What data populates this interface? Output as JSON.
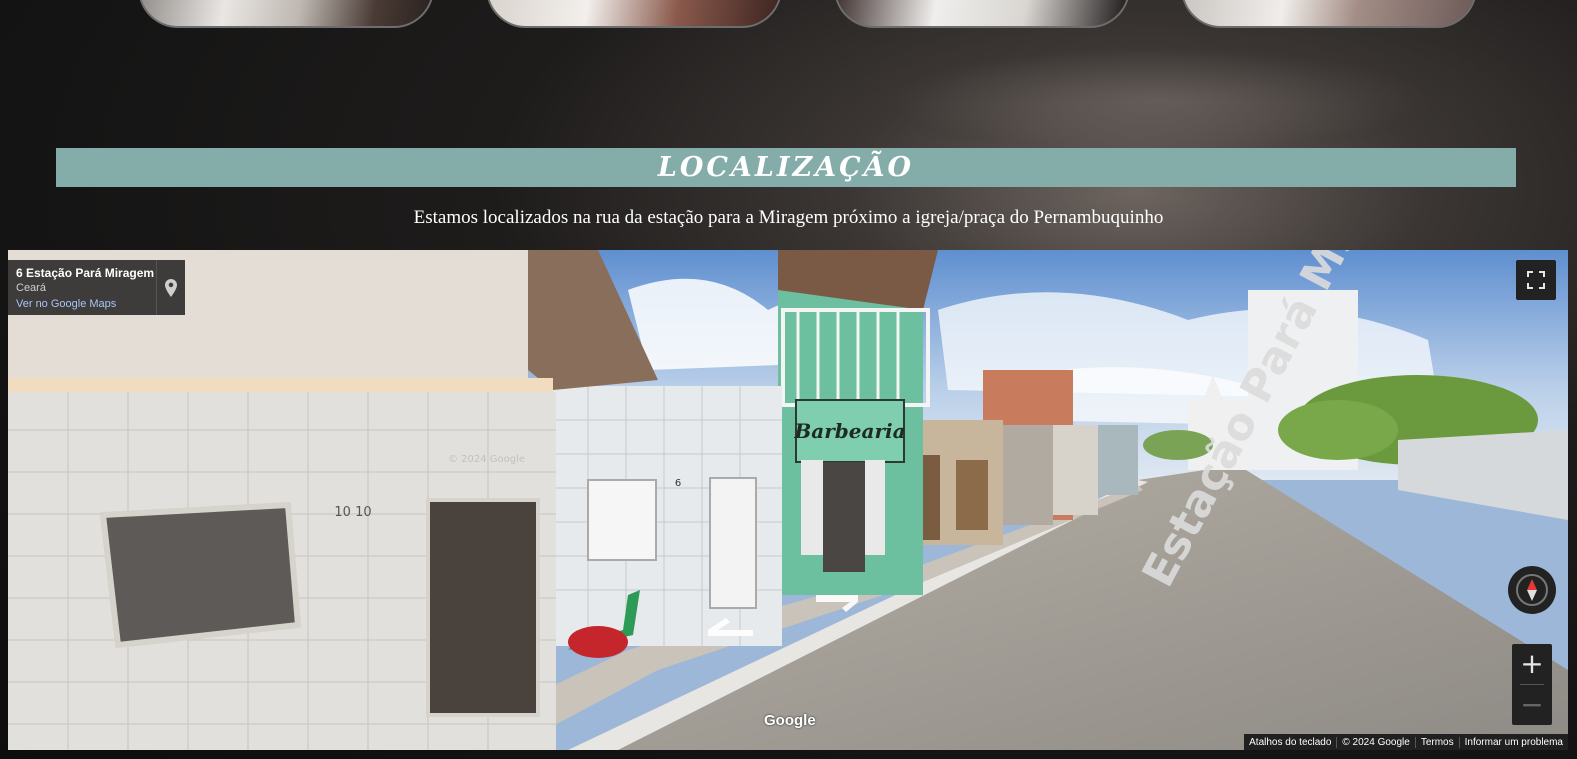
{
  "section": {
    "title": "LOCALIZAÇÃO",
    "subtitle": "Estamos localizados na rua da estação para a Miragem próximo a igreja/praça do Pernambuquinho"
  },
  "gallery": {
    "thumbnails": [
      "thumbnail-1",
      "thumbnail-2",
      "thumbnail-3",
      "thumbnail-4"
    ]
  },
  "map": {
    "place_name": "6 Estação Pará Miragem",
    "region": "Ceará",
    "view_link": "Ver no Google Maps",
    "logo": "Google",
    "scene_text": {
      "shop_sign": "Barbearia",
      "house_number_left": "10 10",
      "house_number_mid": "6",
      "street_label": "Estação Pará Miragem",
      "watermark": "© 2024 Google"
    },
    "footer": {
      "shortcuts": "Atalhos do teclado",
      "copyright": "© 2024 Google",
      "terms": "Termos",
      "report": "Informar um problema"
    },
    "icons": {
      "pin": "map-pin-icon",
      "fullscreen": "fullscreen-icon",
      "compass": "compass-icon",
      "zoom_in": "+",
      "zoom_out": "−"
    }
  },
  "colors": {
    "section_bar": "#84aca8",
    "map_overlay": "#222222",
    "link": "#a9c4f5"
  }
}
